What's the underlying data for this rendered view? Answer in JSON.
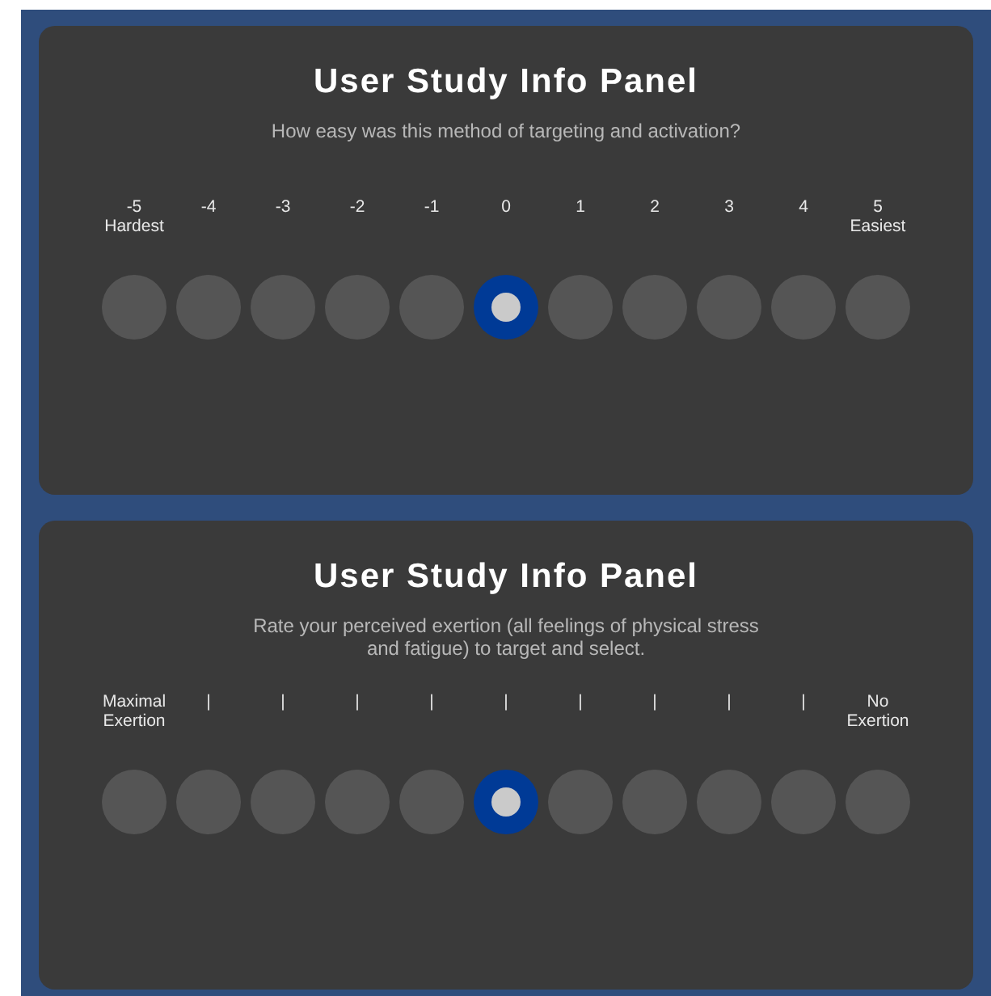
{
  "panels": [
    {
      "title": "User Study Info Panel",
      "question": "How easy was this method of targeting and activation?",
      "options": [
        {
          "label": "-5\nHardest",
          "selected": false
        },
        {
          "label": "-4",
          "selected": false
        },
        {
          "label": "-3",
          "selected": false
        },
        {
          "label": "-2",
          "selected": false
        },
        {
          "label": "-1",
          "selected": false
        },
        {
          "label": "0",
          "selected": true
        },
        {
          "label": "1",
          "selected": false
        },
        {
          "label": "2",
          "selected": false
        },
        {
          "label": "3",
          "selected": false
        },
        {
          "label": "4",
          "selected": false
        },
        {
          "label": "5\nEasiest",
          "selected": false
        }
      ]
    },
    {
      "title": "User Study Info Panel",
      "question": "Rate your perceived exertion (all feelings of physical stress and fatigue) to target and select.",
      "options": [
        {
          "label": "Maximal\nExertion",
          "selected": false
        },
        {
          "label": "|",
          "selected": false
        },
        {
          "label": "|",
          "selected": false
        },
        {
          "label": "|",
          "selected": false
        },
        {
          "label": "|",
          "selected": false
        },
        {
          "label": "|",
          "selected": true
        },
        {
          "label": "|",
          "selected": false
        },
        {
          "label": "|",
          "selected": false
        },
        {
          "label": "|",
          "selected": false
        },
        {
          "label": "|",
          "selected": false
        },
        {
          "label": "No\nExertion",
          "selected": false
        }
      ]
    }
  ]
}
